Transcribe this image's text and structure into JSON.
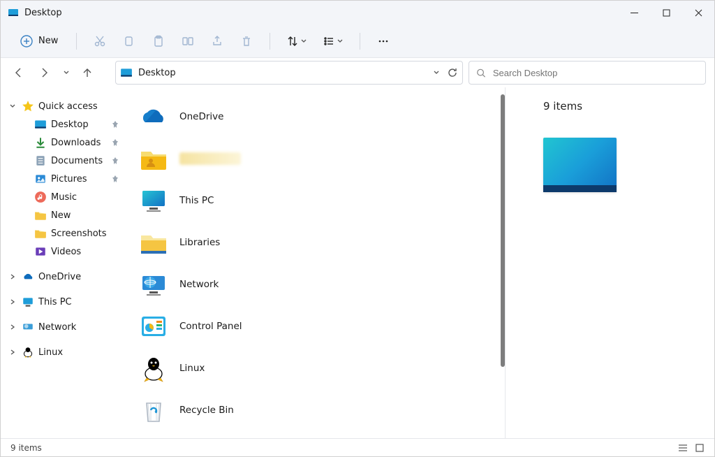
{
  "window": {
    "title": "Desktop"
  },
  "toolbar": {
    "new_label": "New"
  },
  "address": {
    "location": "Desktop"
  },
  "search": {
    "placeholder": "Search Desktop"
  },
  "sidebar": {
    "quick_access": {
      "label": "Quick access"
    },
    "items": [
      {
        "label": "Desktop",
        "pinned": true
      },
      {
        "label": "Downloads",
        "pinned": true
      },
      {
        "label": "Documents",
        "pinned": true
      },
      {
        "label": "Pictures",
        "pinned": true
      },
      {
        "label": "Music",
        "pinned": false
      },
      {
        "label": "New",
        "pinned": false
      },
      {
        "label": "Screenshots",
        "pinned": false
      },
      {
        "label": "Videos",
        "pinned": false
      }
    ],
    "roots": [
      {
        "label": "OneDrive"
      },
      {
        "label": "This PC"
      },
      {
        "label": "Network"
      },
      {
        "label": "Linux"
      }
    ]
  },
  "content": {
    "items": [
      {
        "label": "OneDrive"
      },
      {
        "label": ""
      },
      {
        "label": "This PC"
      },
      {
        "label": "Libraries"
      },
      {
        "label": "Network"
      },
      {
        "label": "Control Panel"
      },
      {
        "label": "Linux"
      },
      {
        "label": "Recycle Bin"
      }
    ]
  },
  "details": {
    "count_label": "9 items"
  },
  "status": {
    "text": "9 items"
  }
}
